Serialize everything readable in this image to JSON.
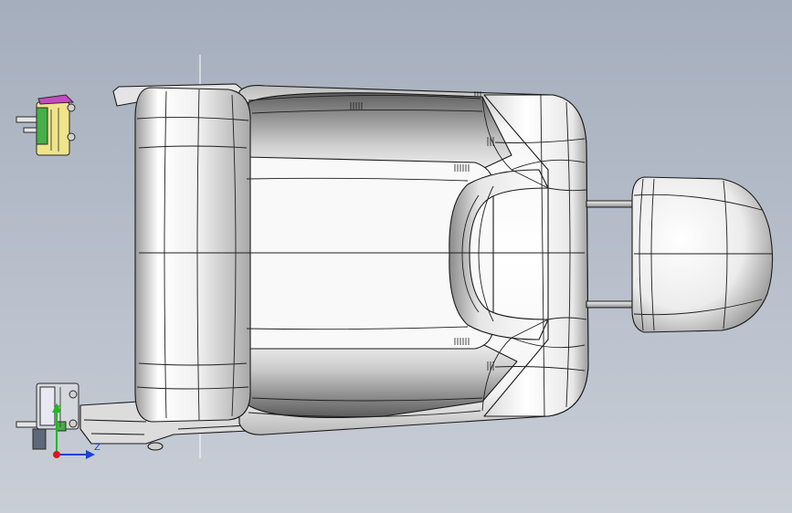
{
  "viewport": {
    "background_top": "#a5aebd",
    "background_bottom": "#c9ced7"
  },
  "model": {
    "name": "seat-assembly",
    "surface_color": "#f2f2f2",
    "shadow_color": "#8f8f8f",
    "edge_color": "#1a1a1a"
  },
  "mounts": {
    "top_color": "#efe48a",
    "bottom_color": "#d4d8dc",
    "accent_color": "#c24cc2",
    "green_color": "#45b045"
  },
  "triad": {
    "y_label": "Y",
    "z_label": "Z",
    "y_color": "#1fb81f",
    "z_color": "#1a40d8",
    "origin_color": "#d41a1a"
  }
}
